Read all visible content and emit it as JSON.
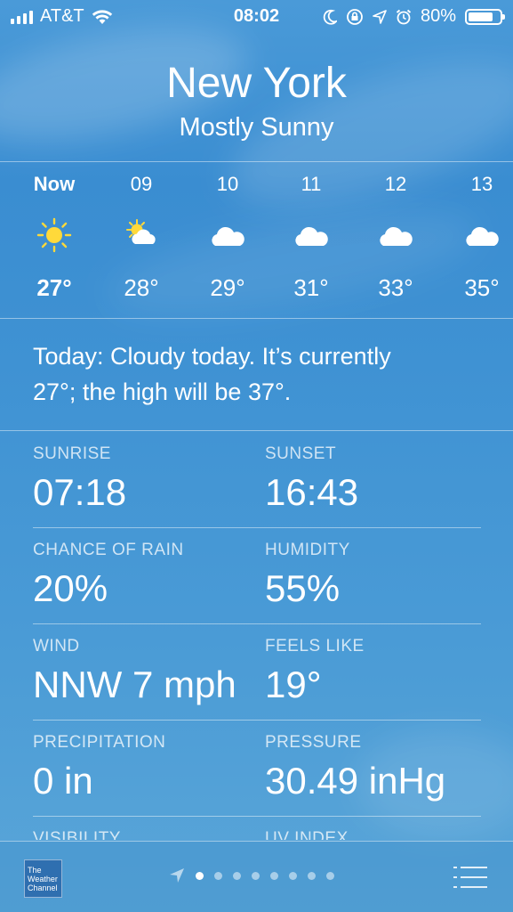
{
  "status_bar": {
    "carrier": "AT&T",
    "time": "08:02",
    "battery": "80%",
    "battery_level": 0.8
  },
  "header": {
    "city": "New York",
    "condition": "Mostly Sunny"
  },
  "hourly": [
    {
      "label": "Now",
      "icon": "sun-icon",
      "temp": "27°"
    },
    {
      "label": "09",
      "icon": "partly-cloudy-icon",
      "temp": "28°"
    },
    {
      "label": "10",
      "icon": "cloud-icon",
      "temp": "29°"
    },
    {
      "label": "11",
      "icon": "cloud-icon",
      "temp": "31°"
    },
    {
      "label": "12",
      "icon": "cloud-icon",
      "temp": "33°"
    },
    {
      "label": "13",
      "icon": "cloud-icon",
      "temp": "35°"
    }
  ],
  "summary": {
    "line1": "Today: Cloudy today. It’s currently",
    "line2": "27°; the high will be 37°."
  },
  "details": [
    {
      "left": {
        "label": "SUNRISE",
        "value": "07:18"
      },
      "right": {
        "label": "SUNSET",
        "value": "16:43"
      }
    },
    {
      "left": {
        "label": "CHANCE OF RAIN",
        "value": "20%"
      },
      "right": {
        "label": "HUMIDITY",
        "value": "55%"
      }
    },
    {
      "left": {
        "label": "WIND",
        "value": "NNW 7 mph"
      },
      "right": {
        "label": "FEELS LIKE",
        "value": "19°"
      }
    },
    {
      "left": {
        "label": "PRECIPITATION",
        "value": "0 in"
      },
      "right": {
        "label": "PRESSURE",
        "value": "30.49 inHg"
      }
    },
    {
      "left": {
        "label": "VISIBILITY",
        "value": ""
      },
      "right": {
        "label": "UV INDEX",
        "value": ""
      }
    }
  ],
  "bottom_bar": {
    "logo_line1": "The",
    "logo_line2": "Weather",
    "logo_line3": "Channel",
    "page_count": 8,
    "active_page": 0
  },
  "colors": {
    "sun": "#ffd93a",
    "background_top": "#4a9ad8",
    "background_bottom": "#5aa6d8"
  }
}
